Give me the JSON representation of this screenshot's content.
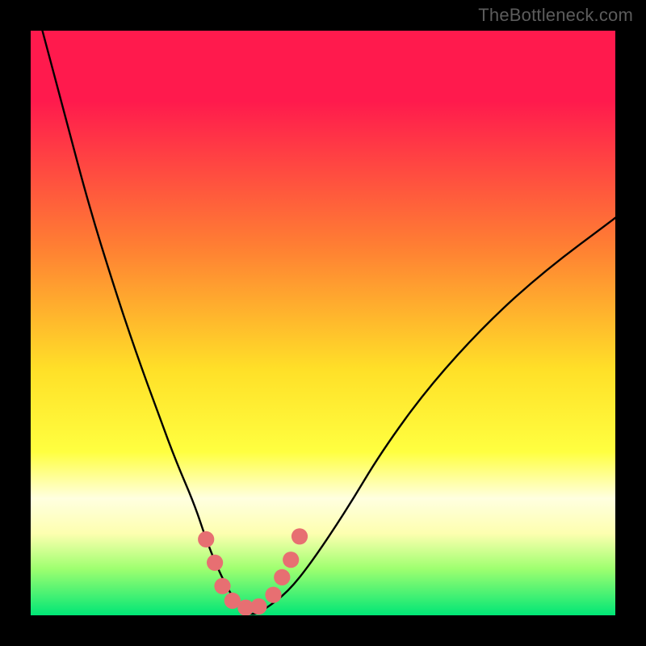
{
  "watermark": "TheBottleneck.com",
  "axes": {
    "x_range": [
      0,
      724
    ],
    "y_range_inverted": [
      0,
      724
    ],
    "gradient_stops": [
      {
        "pct": 0,
        "color": "#ff1a4d"
      },
      {
        "pct": 12,
        "color": "#ff1a4d"
      },
      {
        "pct": 37,
        "color": "#ff7f33"
      },
      {
        "pct": 58,
        "color": "#ffe028"
      },
      {
        "pct": 72,
        "color": "#ffff40"
      },
      {
        "pct": 80,
        "color": "#ffffe0"
      },
      {
        "pct": 86,
        "color": "#fdffb0"
      },
      {
        "pct": 92,
        "color": "#9fff70"
      },
      {
        "pct": 100,
        "color": "#00e676"
      }
    ]
  },
  "chart_data": {
    "type": "line",
    "title": "",
    "xlabel": "",
    "ylabel": "",
    "xlim": [
      0,
      100
    ],
    "ylim": [
      0,
      100
    ],
    "series": [
      {
        "name": "curve",
        "color": "#000000",
        "x": [
          2,
          6,
          10,
          14,
          18,
          22,
          25,
          28,
          30,
          32,
          34,
          36,
          38,
          40,
          44,
          48,
          54,
          60,
          68,
          78,
          88,
          100
        ],
        "values": [
          100,
          85,
          70,
          57,
          45,
          34,
          26,
          19,
          13,
          8,
          4,
          1,
          0,
          1,
          4,
          9,
          18,
          28,
          39,
          50,
          59,
          68
        ]
      }
    ],
    "markers": [
      {
        "x": 30.0,
        "y": 13.0
      },
      {
        "x": 31.5,
        "y": 9.0
      },
      {
        "x": 32.8,
        "y": 5.0
      },
      {
        "x": 34.5,
        "y": 2.5
      },
      {
        "x": 36.8,
        "y": 1.3
      },
      {
        "x": 39.0,
        "y": 1.5
      },
      {
        "x": 41.5,
        "y": 3.5
      },
      {
        "x": 43.0,
        "y": 6.5
      },
      {
        "x": 44.5,
        "y": 9.5
      },
      {
        "x": 46.0,
        "y": 13.5
      }
    ],
    "marker_style": {
      "radius_pct": 1.4,
      "fill": "#e76f72"
    }
  }
}
